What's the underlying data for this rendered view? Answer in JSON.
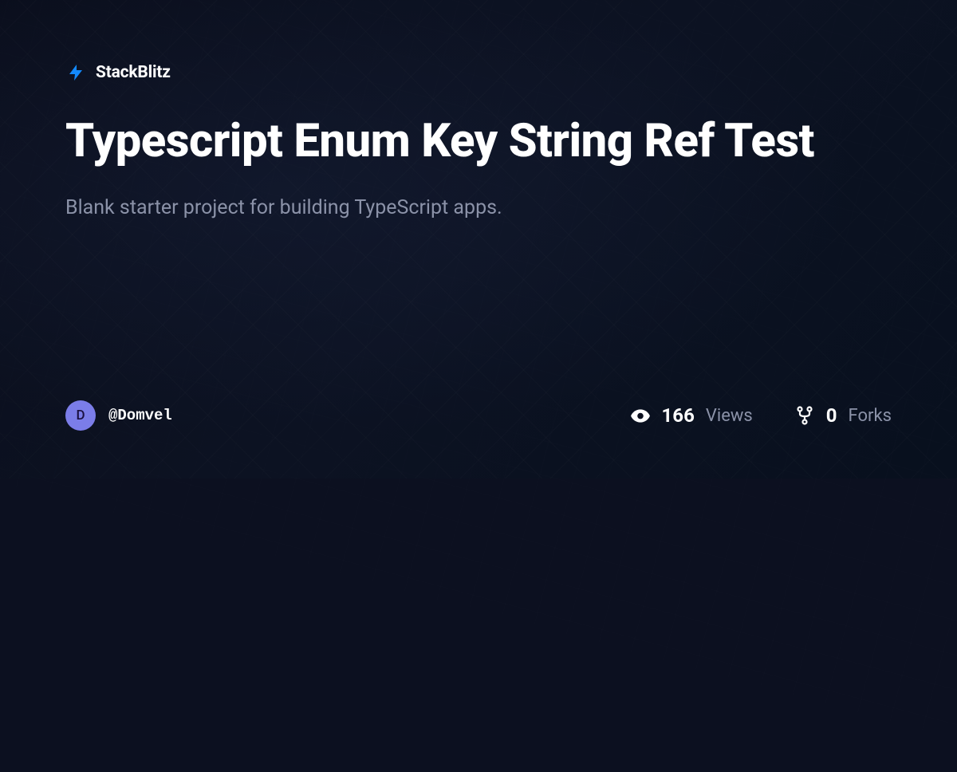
{
  "brand": {
    "name": "StackBlitz",
    "icon": "lightning-bolt-icon",
    "iconColor": "#1389FD"
  },
  "project": {
    "title": "Typescript Enum Key String Ref Test",
    "description": "Blank starter project for building TypeScript apps."
  },
  "author": {
    "avatarLetter": "D",
    "username": "@Domvel"
  },
  "stats": {
    "views": {
      "value": "166",
      "label": "Views"
    },
    "forks": {
      "value": "0",
      "label": "Forks"
    }
  }
}
